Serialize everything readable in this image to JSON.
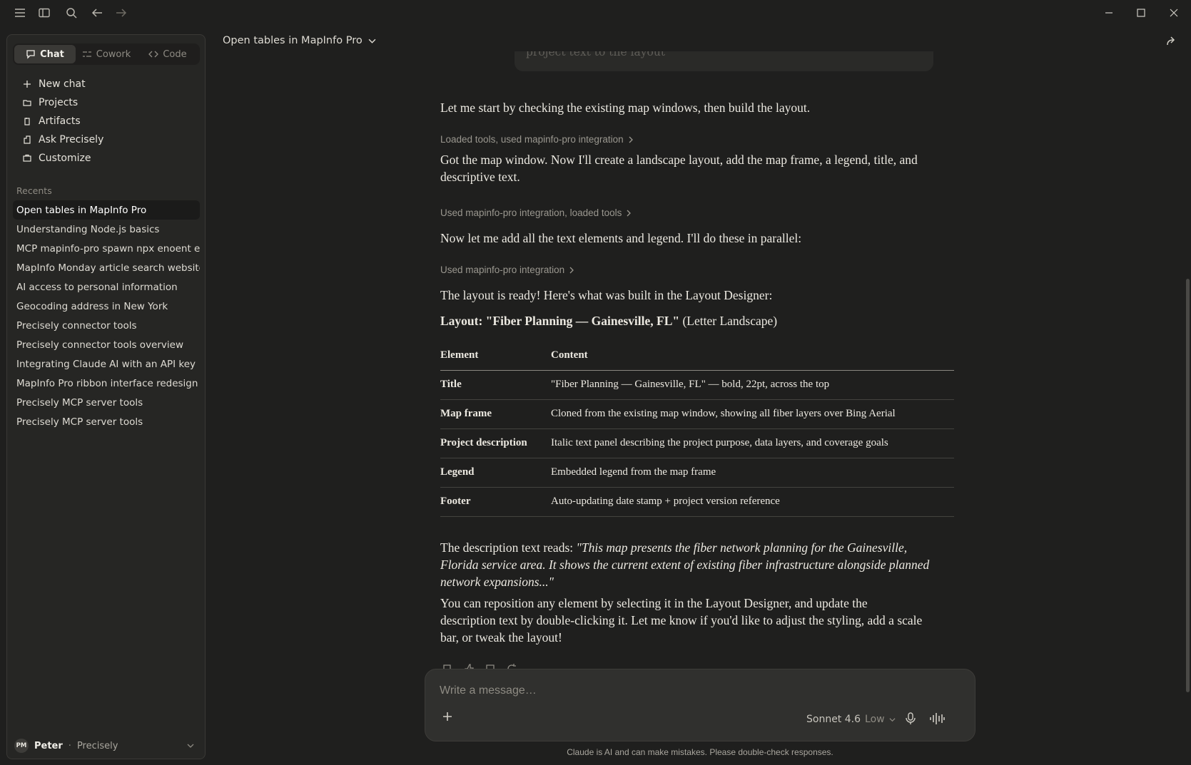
{
  "sidebar": {
    "modes": [
      {
        "label": "Chat",
        "active": true
      },
      {
        "label": "Cowork",
        "active": false
      },
      {
        "label": "Code",
        "active": false
      }
    ],
    "nav": [
      {
        "label": "New chat",
        "icon": "plus-icon"
      },
      {
        "label": "Projects",
        "icon": "folder-icon"
      },
      {
        "label": "Artifacts",
        "icon": "artifacts-icon"
      },
      {
        "label": "Ask Precisely",
        "icon": "connector-icon"
      },
      {
        "label": "Customize",
        "icon": "briefcase-icon"
      }
    ],
    "recents_label": "Recents",
    "recents": [
      "Open tables in MapInfo Pro",
      "Understanding Node.js basics",
      "MCP mapinfo-pro spawn npx enoent error",
      "MapInfo Monday article search website",
      "AI access to personal information",
      "Geocoding address in New York",
      "Precisely connector tools",
      "Precisely connector tools overview",
      "Integrating Claude AI with an API key",
      "MapInfo Pro ribbon interface redesign",
      "Precisely MCP server tools",
      "Precisely MCP server tools"
    ],
    "user": {
      "initials": "PM",
      "name": "Peter",
      "separator": "·",
      "org": "Precisely"
    }
  },
  "header": {
    "title": "Open tables in MapInfo Pro"
  },
  "conversation": {
    "prev_user_fragment": "project text to the layout",
    "msg1": "Let me start by checking the existing map windows, then build the layout.",
    "tool1": "Loaded tools, used mapinfo-pro integration",
    "msg2": "Got the map window. Now I'll create a landscape layout, add the map frame, a legend, title, and descriptive text.",
    "tool2": "Used mapinfo-pro integration, loaded tools",
    "msg3": "Now let me add all the text elements and legend. I'll do these in parallel:",
    "tool3": "Used mapinfo-pro integration",
    "msg4": "The layout is ready! Here's what was built in the Layout Designer:",
    "layout_prefix": "Layout: \"Fiber Planning — Gainesville, FL\"",
    "layout_suffix": " (Letter Landscape)",
    "table": {
      "headers": [
        "Element",
        "Content"
      ],
      "rows": [
        [
          "Title",
          "\"Fiber Planning — Gainesville, FL\" — bold, 22pt, across the top"
        ],
        [
          "Map frame",
          "Cloned from the existing map window, showing all fiber layers over Bing Aerial"
        ],
        [
          "Project description",
          "Italic text panel describing the project purpose, data layers, and coverage goals"
        ],
        [
          "Legend",
          "Embedded legend from the map frame"
        ],
        [
          "Footer",
          "Auto-updating date stamp + project version reference"
        ]
      ]
    },
    "desc_prefix": "The description text reads: ",
    "desc_quote": "\"This map presents the fiber network planning for the Gainesville, Florida service area. It shows the current extent of existing fiber infrastructure alongside planned network expansions...\"",
    "msg5": "You can reposition any element by selecting it in the Layout Designer, and update the description text by double-clicking it. Let me know if you'd like to adjust the styling, add a scale bar, or tweak the layout!"
  },
  "composer": {
    "placeholder": "Write a message…",
    "model": "Sonnet 4.6",
    "effort": "Low"
  },
  "disclaimer": "Claude is AI and can make mistakes. Please double-check responses."
}
